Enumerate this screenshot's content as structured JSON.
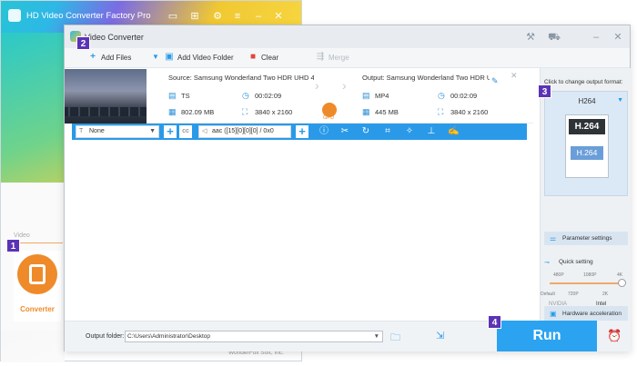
{
  "launcher": {
    "title": "HD Video Converter Factory Pro",
    "section_label": "Video",
    "converter_label": "Converter",
    "footer": "WonderFox Soft, Inc."
  },
  "window": {
    "title": "Video Converter"
  },
  "toolbar": {
    "add_files": "Add Files",
    "add_video_folder": "Add Video Folder",
    "clear": "Clear",
    "merge": "Merge"
  },
  "file": {
    "source_label": "Source: Samsung Wonderland Two HDR UHD 4K...",
    "source_format": "TS",
    "source_duration": "00:02:09",
    "source_size": "802.09 MB",
    "source_resolution": "3840 x 2160",
    "gpu_badge": "GPU",
    "output_label": "Output: Samsung Wonderland Two HDR U...",
    "output_format": "MP4",
    "output_duration": "00:02:09",
    "output_size": "445 MB",
    "output_resolution": "3840 x 2160"
  },
  "edit_bar": {
    "subtitle_value": "None",
    "audio_value": "aac ([15][0][0][0] / 0x0"
  },
  "right_panel": {
    "format_hint": "Click to change output format:",
    "format_name": "H264",
    "format_top_text": "H.264",
    "format_bottom_text": "H.264",
    "parameter_settings": "Parameter settings",
    "quick_setting": "Quick setting",
    "ticks_top": [
      "480P",
      "1080P",
      "4K"
    ],
    "ticks_bottom": [
      "Default",
      "720P",
      "2K"
    ],
    "quick_setting_level": 1.0,
    "hardware_acceleration": "Hardware acceleration",
    "vendor_nvidia": "NVIDIA",
    "vendor_intel": "Intel"
  },
  "bottom": {
    "output_folder_label": "Output folder:",
    "output_folder_value": "C:\\Users\\Administrator\\Desktop",
    "run": "Run"
  },
  "badges": [
    "1",
    "2",
    "3",
    "4"
  ],
  "colors": {
    "accent_blue": "#2a9ae8",
    "run_blue": "#2ba3f0",
    "converter_orange": "#ef8a2a",
    "badge_purple": "#5b33b5"
  }
}
